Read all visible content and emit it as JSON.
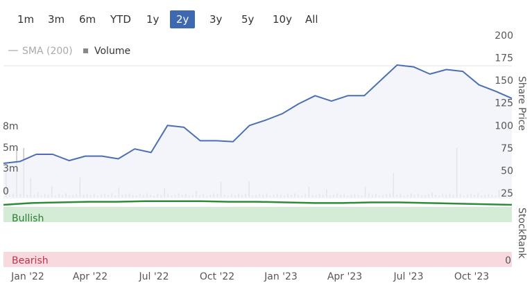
{
  "range_buttons": [
    "1m",
    "3m",
    "6m",
    "YTD",
    "1y",
    "2y",
    "3y",
    "5y",
    "10y",
    "All"
  ],
  "active_range": "2y",
  "legend": {
    "sma_label": "SMA (200)",
    "volume_label": "Volume"
  },
  "colors": {
    "price": "#4a6fb3",
    "price_fill": "#eef1f9",
    "volume": "#c8c8c8",
    "stockrank": "#2e8b3a",
    "bullish_band": "#d4ecd6",
    "bearish_band": "#f7d9de",
    "bearish_text": "#c0334d",
    "bullish_text": "#2e7d32",
    "active_button": "#3e68b0"
  },
  "stockrank": {
    "axis_label": "StockRank",
    "bullish_label": "Bullish",
    "bearish_label": "Bearish",
    "zero_label": "0"
  },
  "chart_data": {
    "type": "line",
    "x_labels": [
      "Jan '22",
      "Apr '22",
      "Jul '22",
      "Oct '22",
      "Jan '23",
      "Apr '23",
      "Jul '23",
      "Oct '23"
    ],
    "price_axis": {
      "label": "Share Price",
      "ticks": [
        25,
        50,
        75,
        100,
        125,
        150,
        175,
        200
      ],
      "range": [
        25,
        200
      ]
    },
    "volume_axis": {
      "ticks_labels": [
        "0",
        "3m",
        "5m",
        "8m"
      ],
      "ticks": [
        0,
        3,
        5,
        8
      ],
      "range": [
        0,
        8
      ]
    },
    "series": [
      {
        "name": "Share Price",
        "points": [
          [
            "Dec '21",
            58
          ],
          [
            "Jan '22",
            60
          ],
          [
            "Feb '22",
            68
          ],
          [
            "Mar '22",
            68
          ],
          [
            "Apr '22",
            61
          ],
          [
            "Apr '22",
            66
          ],
          [
            "May '22",
            66
          ],
          [
            "Jun '22",
            63
          ],
          [
            "Jun '22",
            74
          ],
          [
            "Jul '22",
            70
          ],
          [
            "Aug '22",
            100
          ],
          [
            "Aug '22",
            98
          ],
          [
            "Sep '22",
            83
          ],
          [
            "Oct '22",
            83
          ],
          [
            "Nov '22",
            82
          ],
          [
            "Nov '22",
            100
          ],
          [
            "Dec '22",
            106
          ],
          [
            "Jan '23",
            113
          ],
          [
            "Feb '23",
            124
          ],
          [
            "Mar '23",
            133
          ],
          [
            "Mar '23",
            127
          ],
          [
            "Apr '23",
            133
          ],
          [
            "May '23",
            133
          ],
          [
            "Jun '23",
            150
          ],
          [
            "Jun '23",
            167
          ],
          [
            "Jul '23",
            165
          ],
          [
            "Aug '23",
            157
          ],
          [
            "Sep '23",
            162
          ],
          [
            "Oct '23",
            160
          ],
          [
            "Nov '23",
            145
          ],
          [
            "Dec '23",
            138
          ],
          [
            "Dec '23",
            130
          ]
        ]
      },
      {
        "name": "Volume",
        "values": [
          3.2,
          0.3,
          0.5,
          6.2,
          0.4,
          6.2,
          0.3,
          2.4,
          0.3,
          0.6,
          0.2,
          0.4,
          0.3,
          1.4,
          0.2,
          0.4,
          0.3,
          0.5,
          0.2,
          0.3,
          0.4,
          2.5,
          0.3,
          0.4,
          0.3,
          0.5,
          0.2,
          0.3,
          0.4,
          0.3,
          0.5,
          0.2,
          1.2,
          0.3,
          0.4,
          0.5,
          0.3,
          0.2,
          0.4,
          0.3,
          0.5,
          0.3,
          0.2,
          0.4,
          0.3,
          1.1,
          0.4,
          0.2,
          0.3,
          0.5,
          0.3,
          0.4,
          0.2,
          0.3,
          0.8,
          0.3,
          0.4,
          0.2,
          0.3,
          0.5,
          0.4,
          1.9,
          0.3,
          0.2,
          0.4,
          0.3,
          0.5,
          0.3,
          0.4,
          2.0,
          0.2,
          0.3,
          0.4,
          0.3,
          0.5,
          0.2,
          0.3,
          0.4,
          0.3,
          0.2,
          0.4,
          0.3,
          0.5,
          0.3,
          0.2,
          0.4,
          1.3,
          0.3,
          0.2,
          0.4,
          0.3,
          1.0,
          0.2,
          0.3,
          0.5,
          0.3,
          0.4,
          0.2,
          0.3,
          0.4,
          0.3,
          0.2,
          1.3,
          0.5,
          0.3,
          0.4,
          0.2,
          0.3,
          0.4,
          0.5,
          3.1,
          0.3,
          0.4,
          0.2,
          0.3,
          0.5,
          0.3,
          0.4,
          0.2,
          0.3,
          0.4,
          0.6,
          0.3,
          0.2,
          0.4,
          0.3,
          0.5,
          0.3,
          6.2,
          0.4,
          0.2,
          0.3,
          0.4,
          0.3,
          0.5,
          0.2,
          0.3,
          0.4,
          0.3,
          0.2,
          0.9,
          0.3,
          0.4
        ]
      },
      {
        "name": "StockRank",
        "values": [
          92,
          95,
          96,
          97,
          97,
          98,
          98,
          98,
          97,
          97,
          96,
          95,
          95,
          96,
          96,
          95,
          94,
          93,
          92
        ]
      }
    ]
  }
}
